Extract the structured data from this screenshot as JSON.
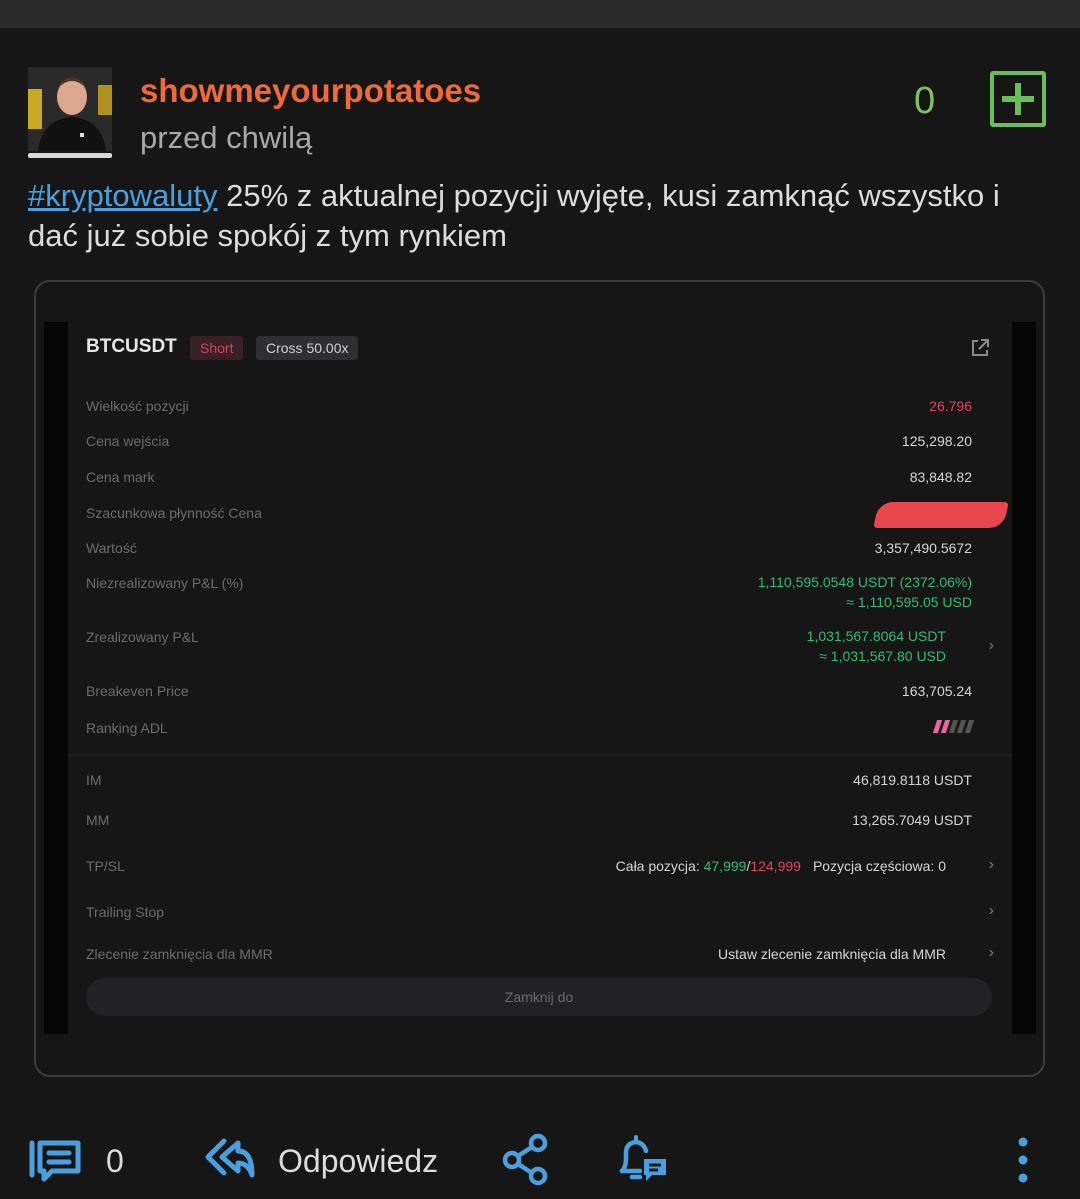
{
  "post": {
    "author": "showmeyourpotatoes",
    "time": "przed chwilą",
    "votes": "0",
    "tag": "#kryptowaluty",
    "body": " 25% z aktualnej pozycji wyjęte, kusi zamknąć wszystko i dać już sobie spokój z tym rynkiem"
  },
  "screenshot": {
    "symbol": "BTCUSDT",
    "side": "Short",
    "margin_mode": "Cross 50.00x",
    "rows": [
      {
        "label": "Wielkość pozycji",
        "value": "26.796"
      },
      {
        "label": "Cena wejścia",
        "value": "125,298.20"
      },
      {
        "label": "Cena mark",
        "value": "83,848.82"
      },
      {
        "label": "Szacunkowa płynność Cena",
        "value": ""
      },
      {
        "label": "Wartość",
        "value": "3,357,490.5672"
      },
      {
        "label": "Niezrealizowany P&L (%)",
        "value": "1,110,595.0548 USDT (2372.06%)",
        "value2": "≈ 1,110,595.05 USD"
      },
      {
        "label": "Zrealizowany P&L",
        "value": "1,031,567.8064 USDT",
        "value2": "≈ 1,031,567.80 USD"
      },
      {
        "label": "Breakeven Price",
        "value": "163,705.24"
      },
      {
        "label": "Ranking ADL",
        "value": ""
      },
      {
        "label": "IM",
        "value": "46,819.8118 USDT"
      },
      {
        "label": "MM",
        "value": "13,265.7049 USDT"
      },
      {
        "label": "TP/SL",
        "value": ""
      },
      {
        "label": "Trailing Stop",
        "value": ""
      },
      {
        "label": "Zlecenie zamknięcia dla MMR",
        "value": "Ustaw zlecenie zamknięcia dla MMR"
      }
    ],
    "tpsl": {
      "full_label": "Cała pozycja: ",
      "tp": "47,999",
      "sep": "/",
      "sl": "124,999",
      "partial": "Pozycja częściowa: 0"
    },
    "adl_level": 2,
    "adl_total": 5,
    "close_button": "Zamknij do"
  },
  "actions": {
    "comments": "0",
    "reply": "Odpowiedz"
  },
  "colors": {
    "username": "#ef6a35",
    "vote": "#7cc35e",
    "tag": "#4aa0de",
    "loss": "#e04659",
    "profit": "#2ebd72"
  }
}
